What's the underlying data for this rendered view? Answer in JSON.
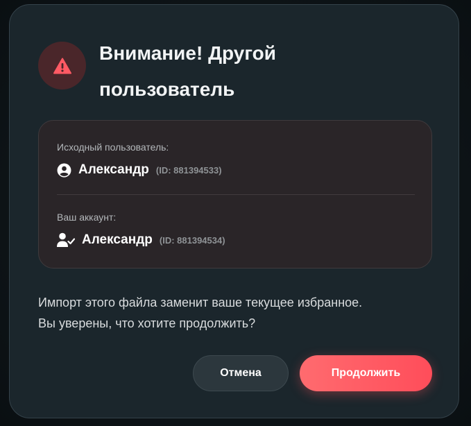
{
  "dialog": {
    "title": "Внимание! Другой пользователь",
    "warning_icon": "warning-triangle-icon",
    "accent_color": "#ff5a64"
  },
  "source_user": {
    "caption": "Исходный пользователь:",
    "name": "Александр",
    "id_text": "(ID: 881394533)",
    "icon": "user-circle-icon"
  },
  "your_account": {
    "caption": "Ваш аккаунт:",
    "name": "Александр",
    "id_text": "(ID: 881394534)",
    "icon": "user-check-icon"
  },
  "message": {
    "line1": "Импорт этого файла заменит ваше текущее избранное.",
    "line2": "Вы уверены, что хотите продолжить?"
  },
  "buttons": {
    "cancel_label": "Отмена",
    "continue_label": "Продолжить"
  }
}
